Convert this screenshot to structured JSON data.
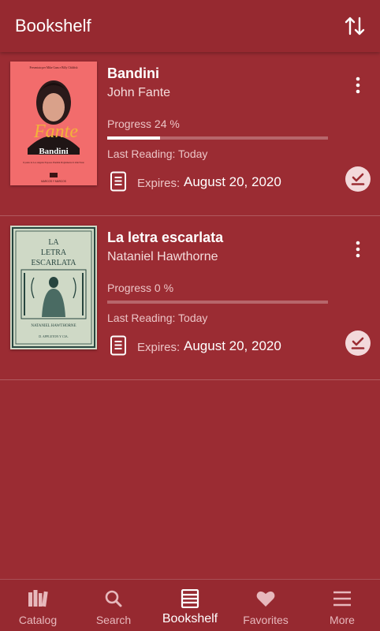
{
  "app": {
    "title": "Bookshelf",
    "colors": {
      "background": "#9b2c33",
      "bar": "#962930",
      "accent": "#ffffff",
      "badge": "#f3d9db"
    }
  },
  "toolbar": {
    "sort_icon": "sort-arrows-icon"
  },
  "books": [
    {
      "title": "Bandini",
      "author": "John Fante",
      "progress_label": "Progress 24 %",
      "progress_fraction": 0.24,
      "last_reading": "Last Reading: Today",
      "expires_label": "Expires:",
      "expires_date": "August 20, 2020",
      "cover": {
        "top_line": "Presentato per Mike Gans e Billy Childish",
        "author_script": "Fante",
        "title": "Bandini",
        "blurb": "Il punto de Los Angeles Exposes. Bandini Preglamente di John Fante",
        "publisher": "MARCOS Y MARCOS"
      }
    },
    {
      "title": "La letra escarlata",
      "author": "Nataniel Hawthorne",
      "progress_label": "Progress 0 %",
      "progress_fraction": 0.0,
      "last_reading": "Last Reading: Today",
      "expires_label": "Expires:",
      "expires_date": "August 20, 2020",
      "cover": {
        "title_line1": "LA",
        "title_line2": "LETRA",
        "title_line3": "ESCARLATA",
        "author": "NATANIEL HAWTHORNE",
        "publisher": "D. APPLETON Y CIA."
      }
    }
  ],
  "nav": [
    {
      "label": "Catalog",
      "icon": "catalog-books-icon",
      "active": false
    },
    {
      "label": "Search",
      "icon": "search-icon",
      "active": false
    },
    {
      "label": "Bookshelf",
      "icon": "bookshelf-list-icon",
      "active": true
    },
    {
      "label": "Favorites",
      "icon": "heart-icon",
      "active": false
    },
    {
      "label": "More",
      "icon": "menu-icon",
      "active": false
    }
  ]
}
